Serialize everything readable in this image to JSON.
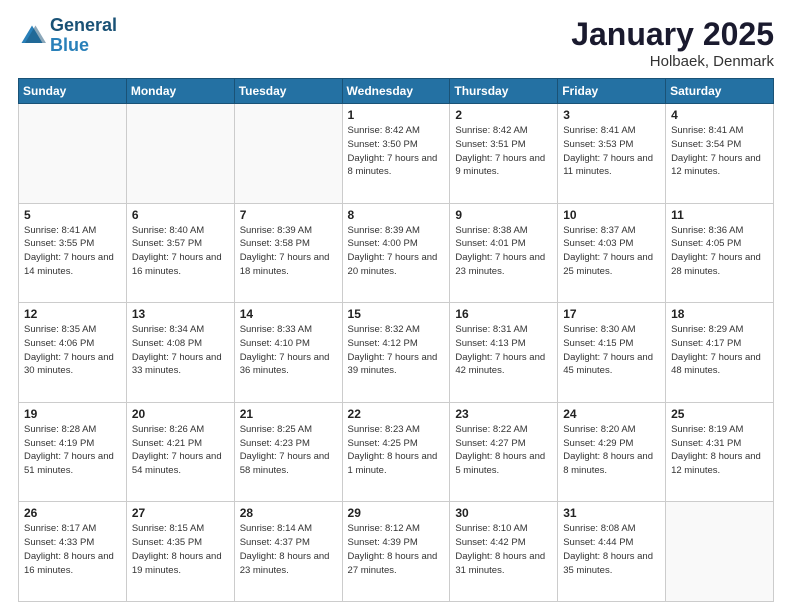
{
  "header": {
    "logo_line1": "General",
    "logo_line2": "Blue",
    "month": "January 2025",
    "location": "Holbaek, Denmark"
  },
  "weekdays": [
    "Sunday",
    "Monday",
    "Tuesday",
    "Wednesday",
    "Thursday",
    "Friday",
    "Saturday"
  ],
  "weeks": [
    [
      {
        "day": "",
        "sunrise": "",
        "sunset": "",
        "daylight": ""
      },
      {
        "day": "",
        "sunrise": "",
        "sunset": "",
        "daylight": ""
      },
      {
        "day": "",
        "sunrise": "",
        "sunset": "",
        "daylight": ""
      },
      {
        "day": "1",
        "sunrise": "Sunrise: 8:42 AM",
        "sunset": "Sunset: 3:50 PM",
        "daylight": "Daylight: 7 hours and 8 minutes."
      },
      {
        "day": "2",
        "sunrise": "Sunrise: 8:42 AM",
        "sunset": "Sunset: 3:51 PM",
        "daylight": "Daylight: 7 hours and 9 minutes."
      },
      {
        "day": "3",
        "sunrise": "Sunrise: 8:41 AM",
        "sunset": "Sunset: 3:53 PM",
        "daylight": "Daylight: 7 hours and 11 minutes."
      },
      {
        "day": "4",
        "sunrise": "Sunrise: 8:41 AM",
        "sunset": "Sunset: 3:54 PM",
        "daylight": "Daylight: 7 hours and 12 minutes."
      }
    ],
    [
      {
        "day": "5",
        "sunrise": "Sunrise: 8:41 AM",
        "sunset": "Sunset: 3:55 PM",
        "daylight": "Daylight: 7 hours and 14 minutes."
      },
      {
        "day": "6",
        "sunrise": "Sunrise: 8:40 AM",
        "sunset": "Sunset: 3:57 PM",
        "daylight": "Daylight: 7 hours and 16 minutes."
      },
      {
        "day": "7",
        "sunrise": "Sunrise: 8:39 AM",
        "sunset": "Sunset: 3:58 PM",
        "daylight": "Daylight: 7 hours and 18 minutes."
      },
      {
        "day": "8",
        "sunrise": "Sunrise: 8:39 AM",
        "sunset": "Sunset: 4:00 PM",
        "daylight": "Daylight: 7 hours and 20 minutes."
      },
      {
        "day": "9",
        "sunrise": "Sunrise: 8:38 AM",
        "sunset": "Sunset: 4:01 PM",
        "daylight": "Daylight: 7 hours and 23 minutes."
      },
      {
        "day": "10",
        "sunrise": "Sunrise: 8:37 AM",
        "sunset": "Sunset: 4:03 PM",
        "daylight": "Daylight: 7 hours and 25 minutes."
      },
      {
        "day": "11",
        "sunrise": "Sunrise: 8:36 AM",
        "sunset": "Sunset: 4:05 PM",
        "daylight": "Daylight: 7 hours and 28 minutes."
      }
    ],
    [
      {
        "day": "12",
        "sunrise": "Sunrise: 8:35 AM",
        "sunset": "Sunset: 4:06 PM",
        "daylight": "Daylight: 7 hours and 30 minutes."
      },
      {
        "day": "13",
        "sunrise": "Sunrise: 8:34 AM",
        "sunset": "Sunset: 4:08 PM",
        "daylight": "Daylight: 7 hours and 33 minutes."
      },
      {
        "day": "14",
        "sunrise": "Sunrise: 8:33 AM",
        "sunset": "Sunset: 4:10 PM",
        "daylight": "Daylight: 7 hours and 36 minutes."
      },
      {
        "day": "15",
        "sunrise": "Sunrise: 8:32 AM",
        "sunset": "Sunset: 4:12 PM",
        "daylight": "Daylight: 7 hours and 39 minutes."
      },
      {
        "day": "16",
        "sunrise": "Sunrise: 8:31 AM",
        "sunset": "Sunset: 4:13 PM",
        "daylight": "Daylight: 7 hours and 42 minutes."
      },
      {
        "day": "17",
        "sunrise": "Sunrise: 8:30 AM",
        "sunset": "Sunset: 4:15 PM",
        "daylight": "Daylight: 7 hours and 45 minutes."
      },
      {
        "day": "18",
        "sunrise": "Sunrise: 8:29 AM",
        "sunset": "Sunset: 4:17 PM",
        "daylight": "Daylight: 7 hours and 48 minutes."
      }
    ],
    [
      {
        "day": "19",
        "sunrise": "Sunrise: 8:28 AM",
        "sunset": "Sunset: 4:19 PM",
        "daylight": "Daylight: 7 hours and 51 minutes."
      },
      {
        "day": "20",
        "sunrise": "Sunrise: 8:26 AM",
        "sunset": "Sunset: 4:21 PM",
        "daylight": "Daylight: 7 hours and 54 minutes."
      },
      {
        "day": "21",
        "sunrise": "Sunrise: 8:25 AM",
        "sunset": "Sunset: 4:23 PM",
        "daylight": "Daylight: 7 hours and 58 minutes."
      },
      {
        "day": "22",
        "sunrise": "Sunrise: 8:23 AM",
        "sunset": "Sunset: 4:25 PM",
        "daylight": "Daylight: 8 hours and 1 minute."
      },
      {
        "day": "23",
        "sunrise": "Sunrise: 8:22 AM",
        "sunset": "Sunset: 4:27 PM",
        "daylight": "Daylight: 8 hours and 5 minutes."
      },
      {
        "day": "24",
        "sunrise": "Sunrise: 8:20 AM",
        "sunset": "Sunset: 4:29 PM",
        "daylight": "Daylight: 8 hours and 8 minutes."
      },
      {
        "day": "25",
        "sunrise": "Sunrise: 8:19 AM",
        "sunset": "Sunset: 4:31 PM",
        "daylight": "Daylight: 8 hours and 12 minutes."
      }
    ],
    [
      {
        "day": "26",
        "sunrise": "Sunrise: 8:17 AM",
        "sunset": "Sunset: 4:33 PM",
        "daylight": "Daylight: 8 hours and 16 minutes."
      },
      {
        "day": "27",
        "sunrise": "Sunrise: 8:15 AM",
        "sunset": "Sunset: 4:35 PM",
        "daylight": "Daylight: 8 hours and 19 minutes."
      },
      {
        "day": "28",
        "sunrise": "Sunrise: 8:14 AM",
        "sunset": "Sunset: 4:37 PM",
        "daylight": "Daylight: 8 hours and 23 minutes."
      },
      {
        "day": "29",
        "sunrise": "Sunrise: 8:12 AM",
        "sunset": "Sunset: 4:39 PM",
        "daylight": "Daylight: 8 hours and 27 minutes."
      },
      {
        "day": "30",
        "sunrise": "Sunrise: 8:10 AM",
        "sunset": "Sunset: 4:42 PM",
        "daylight": "Daylight: 8 hours and 31 minutes."
      },
      {
        "day": "31",
        "sunrise": "Sunrise: 8:08 AM",
        "sunset": "Sunset: 4:44 PM",
        "daylight": "Daylight: 8 hours and 35 minutes."
      },
      {
        "day": "",
        "sunrise": "",
        "sunset": "",
        "daylight": ""
      }
    ]
  ]
}
